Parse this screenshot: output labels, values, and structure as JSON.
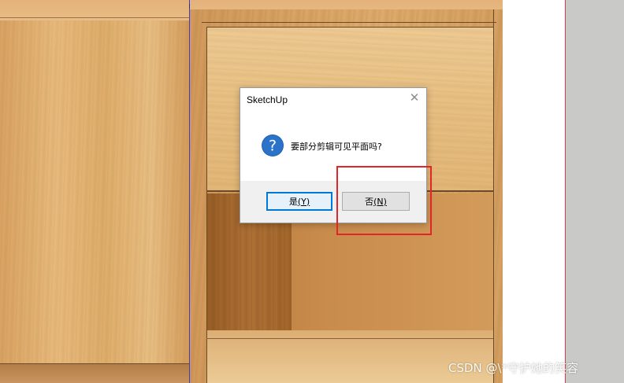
{
  "dialog": {
    "title": "SketchUp",
    "close_glyph": "✕",
    "message": "要部分剪辑可见平面吗?",
    "icon": "question-icon",
    "yes_main": "是",
    "yes_key": "(Y)",
    "no_main": "否",
    "no_key": "(N)"
  },
  "watermark": "CSDN @\\*守护她的笑容",
  "colors": {
    "accent": "#0078d7",
    "highlight": "#e0252b",
    "icon_blue": "#1f62b5"
  }
}
